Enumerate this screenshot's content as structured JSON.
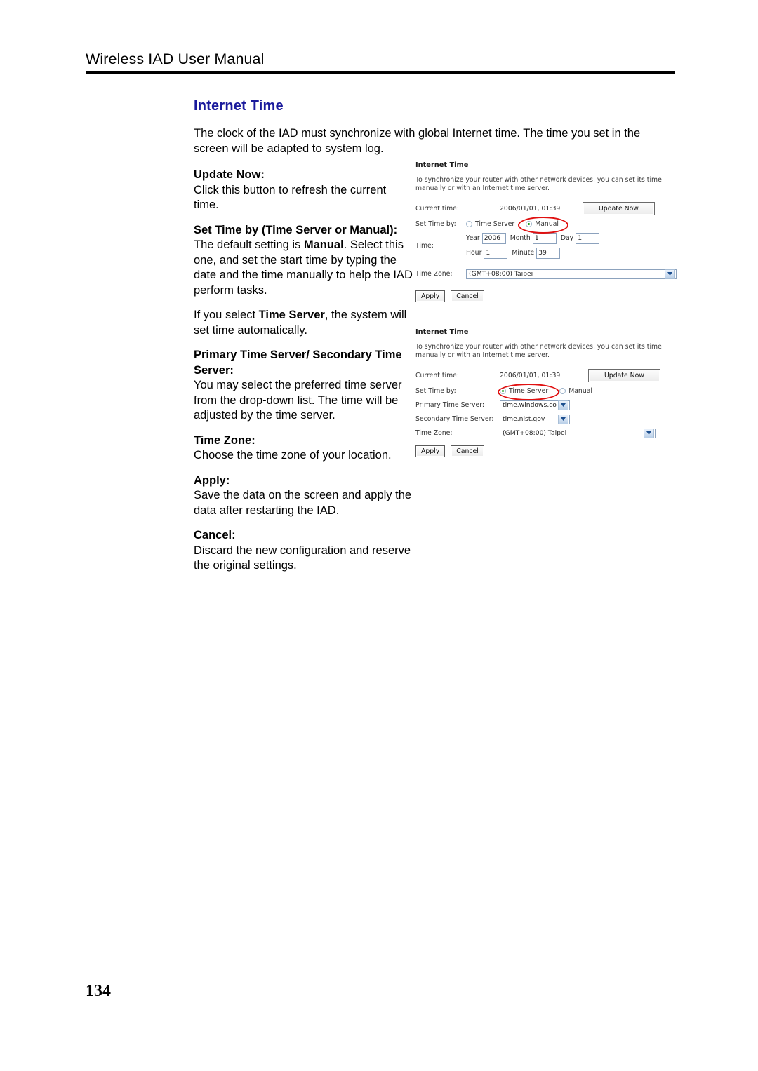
{
  "header": {
    "title": "Wireless IAD User Manual"
  },
  "section": {
    "heading": "Internet Time",
    "intro": "The clock of the IAD must synchronize with global Internet time. The time you set in the screen will be adapted to system log."
  },
  "definitions": [
    {
      "term": "Update Now:",
      "body": "Click this button to refresh the current time."
    },
    {
      "term": "Set Time by (Time Server or Manual):",
      "body_pre": "The default setting is ",
      "body_bold": "Manual",
      "body_post": ". Select this one, and set the start time by typing the date and the time manually to help the IAD perform tasks."
    },
    {
      "term": "",
      "body_pre": "If you select ",
      "body_bold": "Time Server",
      "body_post": ", the system will set time automatically."
    },
    {
      "term": "Primary Time Server/ Secondary Time Server:",
      "body": "You may select the preferred time server from the drop-down list. The time will be adjusted by the time server."
    },
    {
      "term": "Time Zone:",
      "body": "Choose the time zone of your location."
    },
    {
      "term": "Apply:",
      "body": "Save the data on the screen and apply the data after restarting the IAD."
    },
    {
      "term": "Cancel:",
      "body": "Discard the new configuration and reserve the original settings."
    }
  ],
  "screenshot_manual": {
    "title": "Internet Time",
    "description": "To synchronize your router with other network devices, you can set its time manually or with an Internet time server.",
    "current_time_label": "Current time:",
    "current_time_value": "2006/01/01, 01:39",
    "update_now_button": "Update Now",
    "set_time_by_label": "Set Time by:",
    "radio_time_server": "Time Server",
    "radio_manual": "Manual",
    "selected_mode": "Manual",
    "time_label": "Time:",
    "year_label": "Year",
    "year_value": "2006",
    "month_label": "Month",
    "month_value": "1",
    "day_label": "Day",
    "day_value": "1",
    "hour_label": "Hour",
    "hour_value": "1",
    "minute_label": "Minute",
    "minute_value": "39",
    "time_zone_label": "Time Zone:",
    "time_zone_value": "(GMT+08:00) Taipei",
    "apply_button": "Apply",
    "cancel_button": "Cancel"
  },
  "screenshot_server": {
    "title": "Internet Time",
    "description": "To synchronize your router with other network devices, you can set its time manually or with an Internet time server.",
    "current_time_label": "Current time:",
    "current_time_value": "2006/01/01, 01:39",
    "update_now_button": "Update Now",
    "set_time_by_label": "Set Time by:",
    "radio_time_server": "Time Server",
    "radio_manual": "Manual",
    "selected_mode": "Time Server",
    "primary_label": "Primary Time Server:",
    "primary_value": "time.windows.com",
    "secondary_label": "Secondary Time Server:",
    "secondary_value": "time.nist.gov",
    "time_zone_label": "Time Zone:",
    "time_zone_value": "(GMT+08:00) Taipei",
    "apply_button": "Apply",
    "cancel_button": "Cancel"
  },
  "footer": {
    "page_number": "134"
  },
  "colors": {
    "heading": "#1a1a9c",
    "annotation": "#e01010",
    "radio_dot": "#189c18"
  }
}
